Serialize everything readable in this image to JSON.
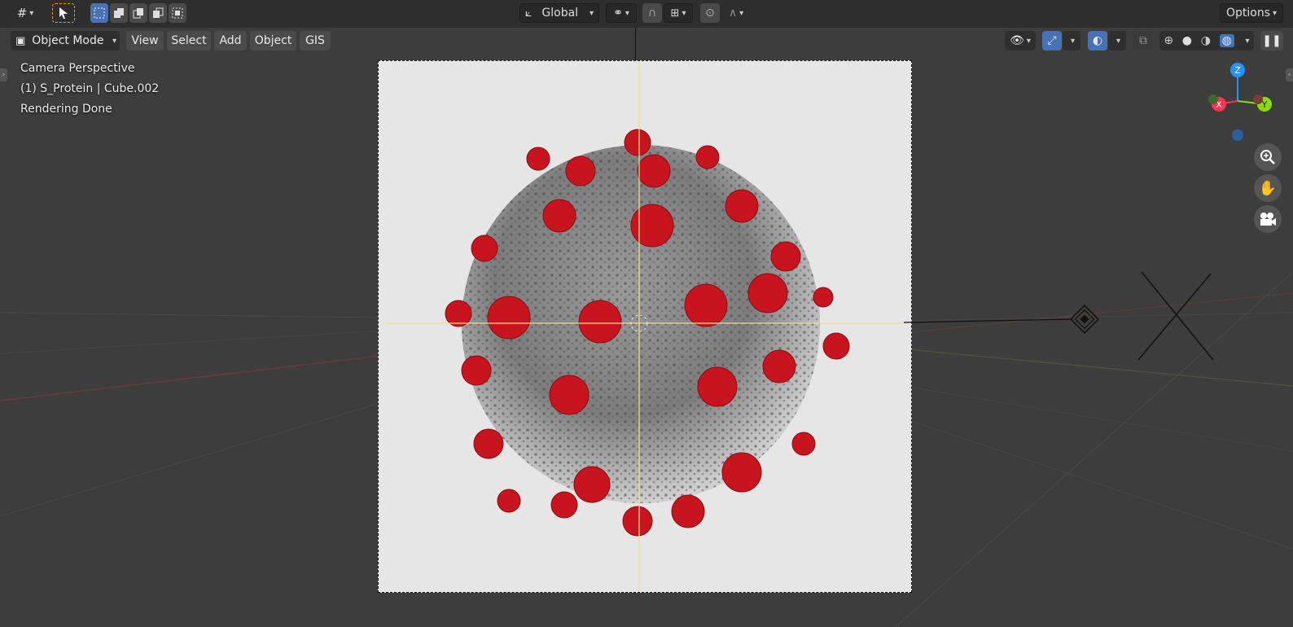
{
  "toolbar": {
    "editor_type_icon": "editor-type-icon",
    "orientation_value": "Global",
    "options_label": "Options"
  },
  "header": {
    "mode_label": "Object Mode",
    "menus": [
      "View",
      "Select",
      "Add",
      "Object",
      "GIS"
    ]
  },
  "overlay": {
    "line1": "Camera Perspective",
    "line2": "(1) S_Protein | Cube.002",
    "line3": "Rendering Done"
  },
  "gizmo": {
    "x_label": "X",
    "y_label": "Y",
    "z_label": "Z",
    "x_color": "#ff3352",
    "y_color": "#8bdc00",
    "z_color": "#2890ff"
  },
  "colors": {
    "accent": "#4772b3",
    "viewport_bg": "#3d3d3d",
    "spike_red": "#c8141e"
  }
}
